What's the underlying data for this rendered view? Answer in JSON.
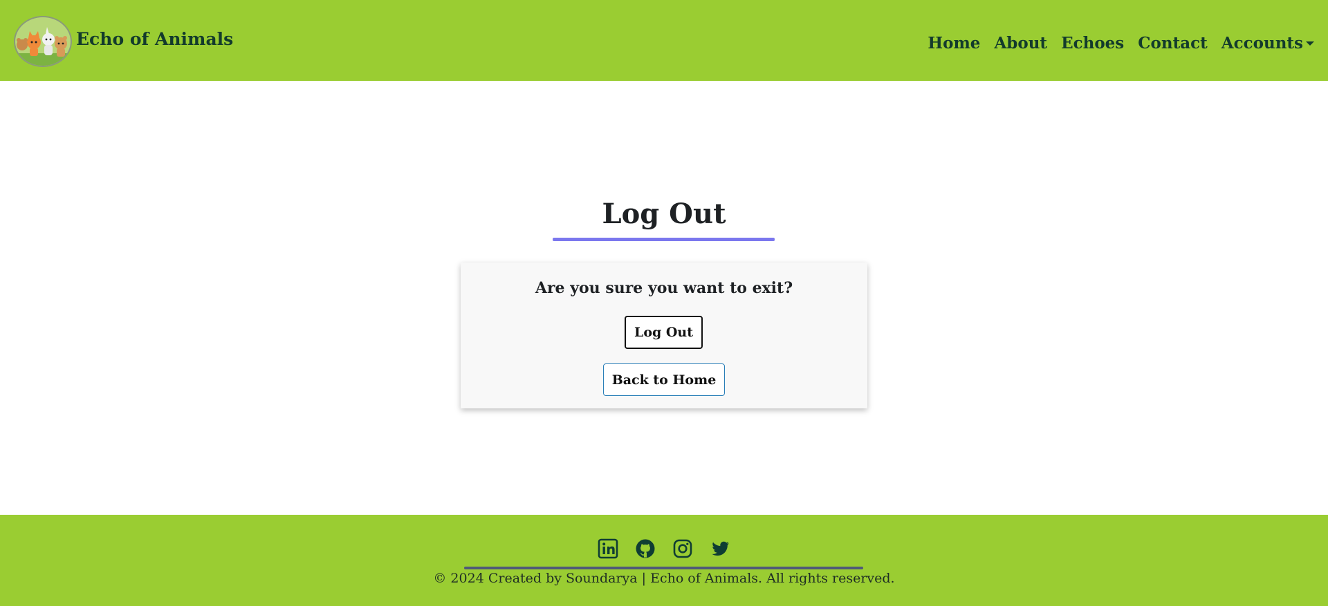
{
  "brand": {
    "name": "Echo of Animals",
    "logo_icon": "animals-logo-icon"
  },
  "nav": {
    "items": [
      {
        "label": "Home"
      },
      {
        "label": "About"
      },
      {
        "label": "Echoes"
      },
      {
        "label": "Contact"
      },
      {
        "label": "Accounts"
      }
    ]
  },
  "main": {
    "title": "Log Out",
    "question": "Are you sure you want to exit?",
    "logout_button": "Log Out",
    "home_button": "Back to Home"
  },
  "footer": {
    "social_icons": [
      "linkedin-icon",
      "github-icon",
      "instagram-icon",
      "twitter-icon"
    ],
    "copyright": "© 2024 Created by Soundarya | Echo of Animals. All rights reserved."
  },
  "colors": {
    "navbar": "#9acd32",
    "brand_text": "#133b2c",
    "title_underline": "#7b77ee",
    "footer_line": "#4f5a78",
    "card_bg": "#f8f8f8"
  }
}
